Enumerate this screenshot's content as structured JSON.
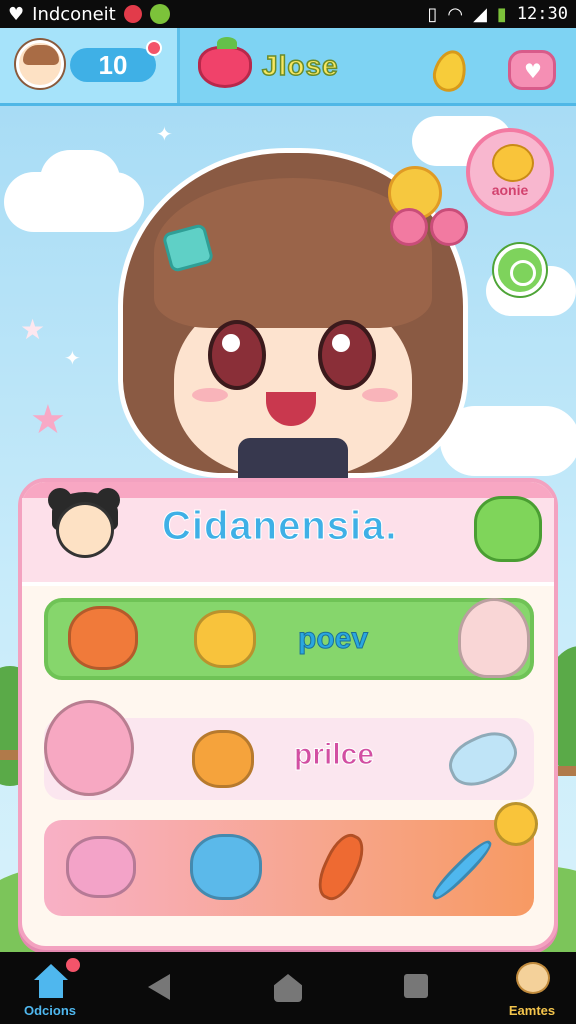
{
  "status_bar": {
    "app_name": "Indconeit",
    "time": "12:30",
    "icons": [
      "heart-icon",
      "notification-red-icon",
      "notification-green-icon",
      "phone-icon",
      "wifi-icon",
      "signal-icon",
      "battery-icon"
    ]
  },
  "header": {
    "level": "10",
    "title": "Jlose",
    "icons": [
      "avatar-icon",
      "strawberry-icon",
      "lemon-icon",
      "gift-heart-icon"
    ]
  },
  "side_buttons": {
    "profile_label": "aonie",
    "chat_icon": "chat-bubble-icon"
  },
  "card": {
    "title": "Cidanensia.",
    "rows": [
      {
        "label": "poev",
        "icons": [
          "orange-creature-icon",
          "yellow-bear-icon",
          "pink-hat-girl-icon"
        ]
      },
      {
        "label": "prilce",
        "icons": [
          "pink-hair-girl-icon",
          "orange-face-icon",
          "blue-crystal-icon"
        ]
      },
      {
        "label": "",
        "icons": [
          "pink-cat-icon",
          "blue-blob-icon",
          "carrot-icon",
          "star-wand-icon"
        ]
      }
    ]
  },
  "nav": {
    "home_label": "Odcions",
    "games_label": "Eamtes"
  },
  "colors": {
    "header_bg": "#7ed3f3",
    "card_border": "#f3a2c0",
    "title_blue": "#3fb0e6",
    "row_green": "#86d66c",
    "row_pink": "#fbe6ef",
    "row_orange": "#f79a63"
  }
}
